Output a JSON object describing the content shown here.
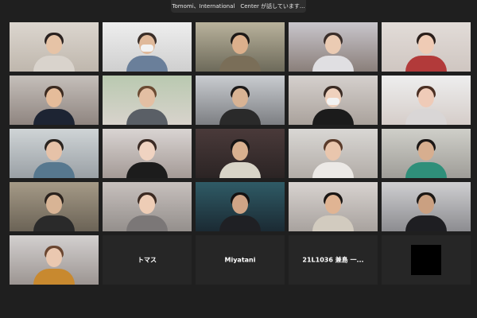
{
  "speaker_banner": "Tomomi、International　Center が話しています...",
  "tiles": [
    {
      "type": "video",
      "bg1": "#dcd6cf",
      "bg2": "#bfb7ad",
      "skin": "#e6c3a6",
      "hair": "#2a2220",
      "shirt": "#d9d3cc"
    },
    {
      "type": "video",
      "bg1": "#eeeeee",
      "bg2": "#cfcfcf",
      "skin": "#e0b99a",
      "hair": "#3a2e28",
      "shirt": "#6a7f9a",
      "mask": true
    },
    {
      "type": "video",
      "bg1": "#b9b29c",
      "bg2": "#6d6a5a",
      "skin": "#dcb08c",
      "hair": "#1d1a18",
      "shirt": "#7a6e58"
    },
    {
      "type": "video",
      "bg1": "#c9c6cc",
      "bg2": "#8a7f7a",
      "skin": "#ebcbb3",
      "hair": "#3a2e2a",
      "shirt": "#e0dfe2"
    },
    {
      "type": "video",
      "bg1": "#e2dcd8",
      "bg2": "#cfc6c1",
      "skin": "#efcbb5",
      "hair": "#2a1f1b",
      "shirt": "#b23a3a"
    },
    {
      "type": "video",
      "bg1": "#c5bfba",
      "bg2": "#8f8580",
      "skin": "#e5bc9a",
      "hair": "#3b2a20",
      "shirt": "#1d2433"
    },
    {
      "type": "video",
      "bg1": "#b9c9b0",
      "bg2": "#d8d3cc",
      "skin": "#e3bfa3",
      "hair": "#6b4b33",
      "shirt": "#5a5f66"
    },
    {
      "type": "video",
      "bg1": "#c9ccd0",
      "bg2": "#7d7f83",
      "skin": "#d8b394",
      "hair": "#1c1a1a",
      "shirt": "#2a2a2a"
    },
    {
      "type": "video",
      "bg1": "#d5d0cd",
      "bg2": "#aaa29c",
      "skin": "#efd1bd",
      "hair": "#3a2b24",
      "shirt": "#1b1b1b",
      "mask": true
    },
    {
      "type": "video",
      "bg1": "#eeeeee",
      "bg2": "#d5cdc9",
      "skin": "#efcbb8",
      "hair": "#4b2f23",
      "shirt": "#d9d6d6"
    },
    {
      "type": "video",
      "bg1": "#cfd4d6",
      "bg2": "#9aa0a5",
      "skin": "#e6c2a8",
      "hair": "#2a2420",
      "shirt": "#57788f"
    },
    {
      "type": "video",
      "bg1": "#d9d4d2",
      "bg2": "#a49a96",
      "skin": "#f0d3c1",
      "hair": "#3a2a24",
      "shirt": "#1c1c1c"
    },
    {
      "type": "video",
      "bg1": "#4a3a3a",
      "bg2": "#2b2424",
      "skin": "#d8b08f",
      "hair": "#151414",
      "shirt": "#d8d4c7"
    },
    {
      "type": "video",
      "bg1": "#d9d7d4",
      "bg2": "#b2aca7",
      "skin": "#e9c6ad",
      "hair": "#5a3b2a",
      "shirt": "#ece9e6"
    },
    {
      "type": "video",
      "bg1": "#cfcfc9",
      "bg2": "#9f9d98",
      "skin": "#d7ae8f",
      "hair": "#1b1716",
      "shirt": "#2f8f7a"
    },
    {
      "type": "video",
      "bg1": "#a59a87",
      "bg2": "#6b6356",
      "skin": "#d8b495",
      "hair": "#2a221d",
      "shirt": "#2a2a2a"
    },
    {
      "type": "video",
      "bg1": "#c7c0bd",
      "bg2": "#948f8c",
      "skin": "#eecdb6",
      "hair": "#3b2a22",
      "shirt": "#7b7777"
    },
    {
      "type": "video",
      "bg1": "#2f5b66",
      "bg2": "#1b2a33",
      "skin": "#cfa486",
      "hair": "#141212",
      "shirt": "#1f2024"
    },
    {
      "type": "video",
      "bg1": "#d8d3d0",
      "bg2": "#a8a29e",
      "skin": "#e0b493",
      "hair": "#1a1614",
      "shirt": "#d2cbbf"
    },
    {
      "type": "video",
      "bg1": "#cfcfd1",
      "bg2": "#8c8c90",
      "skin": "#caa081",
      "hair": "#1c1815",
      "shirt": "#1e1e22"
    },
    {
      "type": "video",
      "bg1": "#d3d0cf",
      "bg2": "#9c9592",
      "skin": "#eac8b0",
      "hair": "#6a4630",
      "shirt": "#c8892f"
    },
    {
      "type": "named",
      "label": "トマス"
    },
    {
      "type": "named",
      "label": "Miyatani"
    },
    {
      "type": "named",
      "label": "21L1036 兼島 一..."
    },
    {
      "type": "blank"
    }
  ]
}
